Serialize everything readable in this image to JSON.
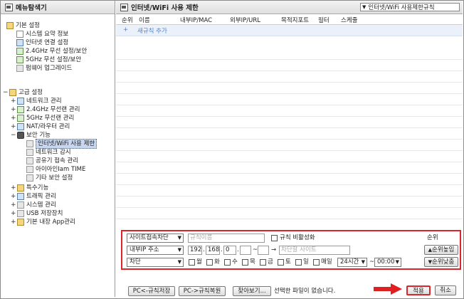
{
  "left": {
    "title": "메뉴탐색기",
    "groups": [
      {
        "label": "기본 설정",
        "items": [
          "시스템 요약 정보",
          "인터넷 연결 설정",
          "2.4GHz 무선 설정/보안",
          "5GHz 무선 설정/보안",
          "펌웨어 업그레이드"
        ]
      },
      {
        "label": "고급 설정",
        "items": [
          "네트워크 관리",
          "2.4GHz 무선랜 관리",
          "5GHz 무선랜 관리",
          "NAT/라우터 관리",
          "보안 기능"
        ],
        "security_items": [
          "인터넷/WiFi 사용 제한",
          "네트워크 감시",
          "공유기 접속 관리",
          "아이아인Iam TIME",
          "기타 보안 설정"
        ],
        "more_items": [
          "특수기능",
          "트래픽 관리",
          "시스템 관리",
          "USB 저장장치",
          "기본 내장 App관리"
        ]
      }
    ]
  },
  "right": {
    "title": "인터넷/WiFi 사용 제한",
    "view_select": "인터넷/WiFi 사용제한규칙",
    "columns": [
      "순위",
      "이름",
      "내부IP/MAC",
      "외부IP/URL",
      "목적지포트",
      "필터",
      "스케줄"
    ],
    "add_rule": "새규칙 추가",
    "editor": {
      "row1": {
        "type": "사이트접속차단",
        "name_placeholder": "규칙이름",
        "disable_label": "규칙 비활성화",
        "order_label": "순위"
      },
      "row2": {
        "ip_type": "내부IP 주소",
        "ip1": "192",
        "ip2": "168",
        "ip3": "0",
        "ip4": "",
        "ip_end": "",
        "site_placeholder": "차단할 사이트",
        "up_button": "순위높임"
      },
      "row3": {
        "action": "차단",
        "days": [
          "월",
          "화",
          "수",
          "목",
          "금",
          "토",
          "일",
          "매일"
        ],
        "time": "24시간",
        "time_end": "00:00",
        "down_button": "순위낮춤"
      }
    },
    "footer": {
      "save_rules": "PC<-규칙저장",
      "restore_rules": "PC->규칙복원",
      "browse": "찾아보기...",
      "no_file": "선택한 파일이 없습니다.",
      "apply": "적용",
      "cancel": "취소"
    }
  },
  "colors": {
    "highlight": "#d9252b",
    "arrow": "#e02020",
    "add_row_bg": "#eaf1fb"
  }
}
